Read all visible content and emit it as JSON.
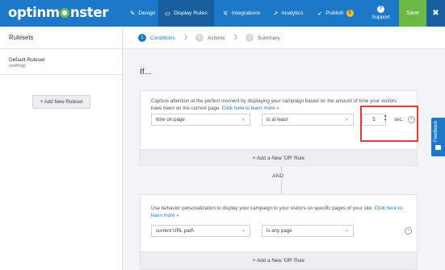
{
  "topbar": {
    "logo": "optinmonster",
    "nav": [
      {
        "label": "Design",
        "icon": "brush-icon"
      },
      {
        "label": "Display Rules",
        "icon": "monitor-icon"
      },
      {
        "label": "Integrations",
        "icon": "plug-icon"
      },
      {
        "label": "Analytics",
        "icon": "chart-icon"
      },
      {
        "label": "Publish",
        "icon": "rocket-icon",
        "badge": "1"
      }
    ],
    "support_label": "Support",
    "support_icon": "?",
    "save_label": "Save",
    "close_icon": "✖"
  },
  "sidebar": {
    "title": "Rulesets",
    "ruleset_name": "Default Ruleset",
    "ruleset_status": "(editing)",
    "add_button": "+ Add New Ruleset"
  },
  "stepper": {
    "steps": [
      {
        "num": "1",
        "label": "Conditions"
      },
      {
        "num": "2",
        "label": "Actions"
      },
      {
        "num": "3",
        "label": "Summary"
      }
    ]
  },
  "main": {
    "if_title": "If...",
    "rule1": {
      "desc_line1": "Capture attention at the perfect moment by displaying your campaign based on the amount of time your visitors",
      "desc_line2": "have been on the current page.",
      "link": "Click here to learn more »",
      "condition": "time on page",
      "operator": "is at least",
      "value": "5",
      "unit": "sec.",
      "add_or": "+ Add a New 'OR' Rule"
    },
    "and_label": "AND",
    "rule2": {
      "desc_line1": "Use behavior personalization to display your campaign to your visitors on specific pages of your site.",
      "link1": "Click here to",
      "link2": "learn more »",
      "condition": "current URL path",
      "operator": "is any page",
      "add_or": "+ Add a New 'OR' Rule"
    }
  },
  "feedback": {
    "label": "Feedback"
  },
  "colors": {
    "brand": "#1d79c7",
    "save": "#6cb844",
    "highlight": "#e53a3a"
  }
}
